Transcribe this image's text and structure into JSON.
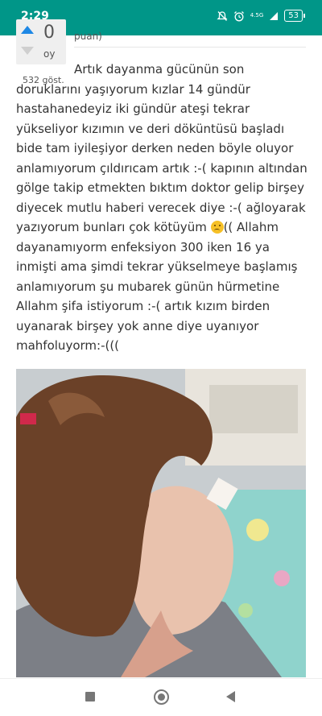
{
  "status_bar": {
    "time": "2:29",
    "network": "4.5G",
    "battery": "53"
  },
  "vote": {
    "count": "0",
    "unit": "oy"
  },
  "views": "532 göst.",
  "points_fragment": "puan)",
  "post": {
    "part1": "Artık dayanma gücünün son doruklarını yaşıyorum kızlar 14 gündür hastahanedeyiz iki gündür ateşi tekrar yükseliyor kızımın ve deri döküntüsü başladı bide tam iyileşiyor derken neden böyle oluyor anlamıyorum çıldırıcam artık :-( kapının altından gölge takip etmekten bıktım doktor gelip birşey diyecek mutlu haberi verecek diye :-( ağloyarak yazıyorum bunları çok kötüyüm ",
    "part2": "(( Allahm dayanamıyorm enfeksiyon 300 iken 16 ya inmişti ama şimdi tekrar yükselmeye başlamış anlamıyorum şu mubarek günün hürmetine Allahm şifa istiyorum :-( artık kızım birden uyanarak birşey yok anne diye uyanıyor mahfoluyorm:-((("
  },
  "colors": {
    "status_bar": "#009688",
    "upvote": "#1e88e5"
  },
  "icons": [
    "mute-icon",
    "alarm-icon",
    "network-icon",
    "battery-icon",
    "sad-face-emoji",
    "nav-recents-icon",
    "nav-home-icon",
    "nav-back-icon"
  ]
}
